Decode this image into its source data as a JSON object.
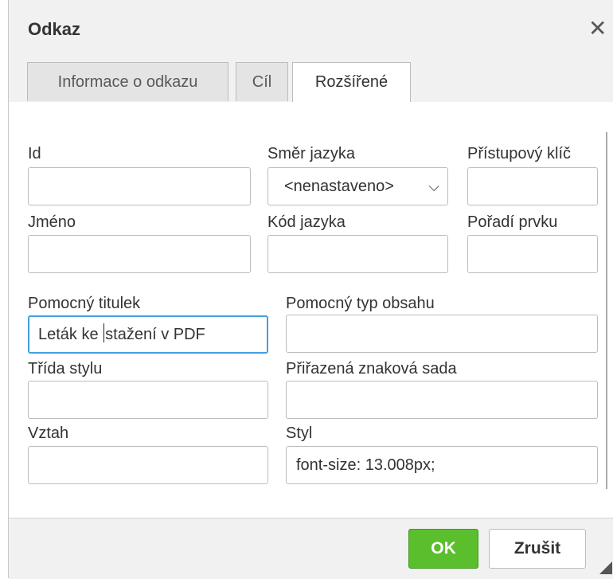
{
  "dialog": {
    "title": "Odkaz",
    "close_glyph": "✕"
  },
  "tabs": [
    {
      "label": "Informace o odkazu",
      "active": false
    },
    {
      "label": "Cíl",
      "active": false
    },
    {
      "label": "Rozšířené",
      "active": true
    }
  ],
  "fields": {
    "id": {
      "label": "Id",
      "value": ""
    },
    "lang_dir": {
      "label": "Směr jazyka",
      "value": "<nenastaveno>"
    },
    "access_key": {
      "label": "Přístupový klíč",
      "value": ""
    },
    "name": {
      "label": "Jméno",
      "value": ""
    },
    "lang_code": {
      "label": "Kód jazyka",
      "value": ""
    },
    "tab_index": {
      "label": "Pořadí prvku",
      "value": ""
    },
    "advisory_title": {
      "label": "Pomocný titulek",
      "value_before_caret": "Leták ke ",
      "value_after_caret": "stažení v PDF"
    },
    "content_type": {
      "label": "Pomocný typ obsahu",
      "value": ""
    },
    "css_class": {
      "label": "Třída stylu",
      "value": ""
    },
    "charset": {
      "label": "Přiřazená znaková sada",
      "value": ""
    },
    "rel": {
      "label": "Vztah",
      "value": ""
    },
    "style": {
      "label": "Styl",
      "value": "font-size: 13.008px;"
    }
  },
  "buttons": {
    "ok": "OK",
    "cancel": "Zrušit"
  },
  "colors": {
    "ok_button": "#5bbf2d",
    "focus_border": "#439fe0"
  }
}
